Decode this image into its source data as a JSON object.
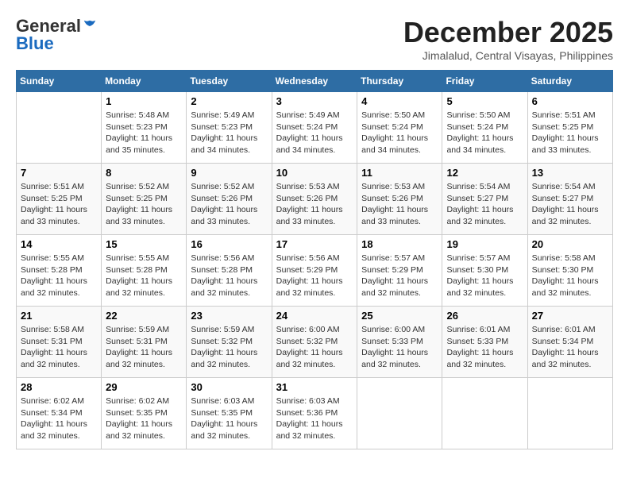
{
  "logo": {
    "general": "General",
    "blue": "Blue"
  },
  "header": {
    "title": "December 2025",
    "location": "Jimalalud, Central Visayas, Philippines"
  },
  "weekdays": [
    "Sunday",
    "Monday",
    "Tuesday",
    "Wednesday",
    "Thursday",
    "Friday",
    "Saturday"
  ],
  "weeks": [
    [
      {
        "day": "",
        "sunrise": "",
        "sunset": "",
        "daylight": ""
      },
      {
        "day": "1",
        "sunrise": "Sunrise: 5:48 AM",
        "sunset": "Sunset: 5:23 PM",
        "daylight": "Daylight: 11 hours and 35 minutes."
      },
      {
        "day": "2",
        "sunrise": "Sunrise: 5:49 AM",
        "sunset": "Sunset: 5:23 PM",
        "daylight": "Daylight: 11 hours and 34 minutes."
      },
      {
        "day": "3",
        "sunrise": "Sunrise: 5:49 AM",
        "sunset": "Sunset: 5:24 PM",
        "daylight": "Daylight: 11 hours and 34 minutes."
      },
      {
        "day": "4",
        "sunrise": "Sunrise: 5:50 AM",
        "sunset": "Sunset: 5:24 PM",
        "daylight": "Daylight: 11 hours and 34 minutes."
      },
      {
        "day": "5",
        "sunrise": "Sunrise: 5:50 AM",
        "sunset": "Sunset: 5:24 PM",
        "daylight": "Daylight: 11 hours and 34 minutes."
      },
      {
        "day": "6",
        "sunrise": "Sunrise: 5:51 AM",
        "sunset": "Sunset: 5:25 PM",
        "daylight": "Daylight: 11 hours and 33 minutes."
      }
    ],
    [
      {
        "day": "7",
        "sunrise": "Sunrise: 5:51 AM",
        "sunset": "Sunset: 5:25 PM",
        "daylight": "Daylight: 11 hours and 33 minutes."
      },
      {
        "day": "8",
        "sunrise": "Sunrise: 5:52 AM",
        "sunset": "Sunset: 5:25 PM",
        "daylight": "Daylight: 11 hours and 33 minutes."
      },
      {
        "day": "9",
        "sunrise": "Sunrise: 5:52 AM",
        "sunset": "Sunset: 5:26 PM",
        "daylight": "Daylight: 11 hours and 33 minutes."
      },
      {
        "day": "10",
        "sunrise": "Sunrise: 5:53 AM",
        "sunset": "Sunset: 5:26 PM",
        "daylight": "Daylight: 11 hours and 33 minutes."
      },
      {
        "day": "11",
        "sunrise": "Sunrise: 5:53 AM",
        "sunset": "Sunset: 5:26 PM",
        "daylight": "Daylight: 11 hours and 33 minutes."
      },
      {
        "day": "12",
        "sunrise": "Sunrise: 5:54 AM",
        "sunset": "Sunset: 5:27 PM",
        "daylight": "Daylight: 11 hours and 32 minutes."
      },
      {
        "day": "13",
        "sunrise": "Sunrise: 5:54 AM",
        "sunset": "Sunset: 5:27 PM",
        "daylight": "Daylight: 11 hours and 32 minutes."
      }
    ],
    [
      {
        "day": "14",
        "sunrise": "Sunrise: 5:55 AM",
        "sunset": "Sunset: 5:28 PM",
        "daylight": "Daylight: 11 hours and 32 minutes."
      },
      {
        "day": "15",
        "sunrise": "Sunrise: 5:55 AM",
        "sunset": "Sunset: 5:28 PM",
        "daylight": "Daylight: 11 hours and 32 minutes."
      },
      {
        "day": "16",
        "sunrise": "Sunrise: 5:56 AM",
        "sunset": "Sunset: 5:28 PM",
        "daylight": "Daylight: 11 hours and 32 minutes."
      },
      {
        "day": "17",
        "sunrise": "Sunrise: 5:56 AM",
        "sunset": "Sunset: 5:29 PM",
        "daylight": "Daylight: 11 hours and 32 minutes."
      },
      {
        "day": "18",
        "sunrise": "Sunrise: 5:57 AM",
        "sunset": "Sunset: 5:29 PM",
        "daylight": "Daylight: 11 hours and 32 minutes."
      },
      {
        "day": "19",
        "sunrise": "Sunrise: 5:57 AM",
        "sunset": "Sunset: 5:30 PM",
        "daylight": "Daylight: 11 hours and 32 minutes."
      },
      {
        "day": "20",
        "sunrise": "Sunrise: 5:58 AM",
        "sunset": "Sunset: 5:30 PM",
        "daylight": "Daylight: 11 hours and 32 minutes."
      }
    ],
    [
      {
        "day": "21",
        "sunrise": "Sunrise: 5:58 AM",
        "sunset": "Sunset: 5:31 PM",
        "daylight": "Daylight: 11 hours and 32 minutes."
      },
      {
        "day": "22",
        "sunrise": "Sunrise: 5:59 AM",
        "sunset": "Sunset: 5:31 PM",
        "daylight": "Daylight: 11 hours and 32 minutes."
      },
      {
        "day": "23",
        "sunrise": "Sunrise: 5:59 AM",
        "sunset": "Sunset: 5:32 PM",
        "daylight": "Daylight: 11 hours and 32 minutes."
      },
      {
        "day": "24",
        "sunrise": "Sunrise: 6:00 AM",
        "sunset": "Sunset: 5:32 PM",
        "daylight": "Daylight: 11 hours and 32 minutes."
      },
      {
        "day": "25",
        "sunrise": "Sunrise: 6:00 AM",
        "sunset": "Sunset: 5:33 PM",
        "daylight": "Daylight: 11 hours and 32 minutes."
      },
      {
        "day": "26",
        "sunrise": "Sunrise: 6:01 AM",
        "sunset": "Sunset: 5:33 PM",
        "daylight": "Daylight: 11 hours and 32 minutes."
      },
      {
        "day": "27",
        "sunrise": "Sunrise: 6:01 AM",
        "sunset": "Sunset: 5:34 PM",
        "daylight": "Daylight: 11 hours and 32 minutes."
      }
    ],
    [
      {
        "day": "28",
        "sunrise": "Sunrise: 6:02 AM",
        "sunset": "Sunset: 5:34 PM",
        "daylight": "Daylight: 11 hours and 32 minutes."
      },
      {
        "day": "29",
        "sunrise": "Sunrise: 6:02 AM",
        "sunset": "Sunset: 5:35 PM",
        "daylight": "Daylight: 11 hours and 32 minutes."
      },
      {
        "day": "30",
        "sunrise": "Sunrise: 6:03 AM",
        "sunset": "Sunset: 5:35 PM",
        "daylight": "Daylight: 11 hours and 32 minutes."
      },
      {
        "day": "31",
        "sunrise": "Sunrise: 6:03 AM",
        "sunset": "Sunset: 5:36 PM",
        "daylight": "Daylight: 11 hours and 32 minutes."
      },
      {
        "day": "",
        "sunrise": "",
        "sunset": "",
        "daylight": ""
      },
      {
        "day": "",
        "sunrise": "",
        "sunset": "",
        "daylight": ""
      },
      {
        "day": "",
        "sunrise": "",
        "sunset": "",
        "daylight": ""
      }
    ]
  ]
}
